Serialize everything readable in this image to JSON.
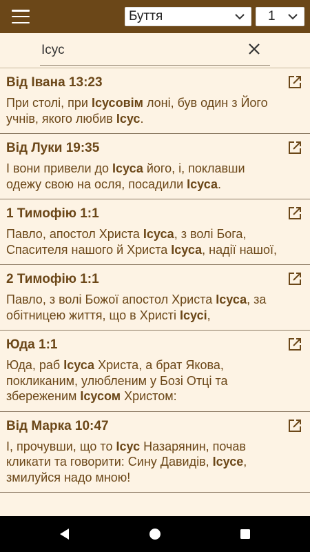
{
  "toolbar": {
    "menu_icon": "hamburger-menu-icon",
    "book": "Буття",
    "chapter": "1"
  },
  "search": {
    "value": "Ісус",
    "clear_icon": "close-icon"
  },
  "results": [
    {
      "ref": "Від Івана 13:23",
      "parts": [
        {
          "t": "При столі, при "
        },
        {
          "t": "Ісусовім",
          "b": true
        },
        {
          "t": " лоні, був один з Його учнів, якого любив "
        },
        {
          "t": "Ісус",
          "b": true
        },
        {
          "t": "."
        }
      ]
    },
    {
      "ref": "Від Луки 19:35",
      "parts": [
        {
          "t": "І вони привели до "
        },
        {
          "t": "Ісуса",
          "b": true
        },
        {
          "t": " його, і, поклавши одежу свою на осля, посадили "
        },
        {
          "t": "Ісуса",
          "b": true
        },
        {
          "t": "."
        }
      ]
    },
    {
      "ref": "1 Тимофію 1:1",
      "parts": [
        {
          "t": "Павло, апостол Христа "
        },
        {
          "t": "Ісуса",
          "b": true
        },
        {
          "t": ", з волі Бога, Спасителя нашого й Христа "
        },
        {
          "t": "Ісуса",
          "b": true
        },
        {
          "t": ", надії нашої,"
        }
      ]
    },
    {
      "ref": "2 Тимофію 1:1",
      "parts": [
        {
          "t": "Павло, з волі Божої апостол Христа "
        },
        {
          "t": "Ісуса",
          "b": true
        },
        {
          "t": ", за обітницею життя, що в Христі "
        },
        {
          "t": "Ісусі",
          "b": true
        },
        {
          "t": ","
        }
      ]
    },
    {
      "ref": "Юда 1:1",
      "parts": [
        {
          "t": "Юда, раб "
        },
        {
          "t": "Ісуса",
          "b": true
        },
        {
          "t": " Христа, а брат Якова, покликаним, улюбленим у Бозі Отці та збереженим "
        },
        {
          "t": "Ісусом",
          "b": true
        },
        {
          "t": " Христом:"
        }
      ]
    },
    {
      "ref": "Від Марка 10:47",
      "parts": [
        {
          "t": "І, прочувши, що то "
        },
        {
          "t": "Ісус",
          "b": true
        },
        {
          "t": " Назарянин, почав кликати та говорити: Сину Давидів, "
        },
        {
          "t": "Ісусе",
          "b": true
        },
        {
          "t": ", змилуйся надо мною!"
        }
      ]
    }
  ],
  "result_action_icon": "open-in-new-icon",
  "navbar": {
    "back_icon": "back-triangle-icon",
    "home_icon": "home-circle-icon",
    "recents_icon": "recents-square-icon"
  },
  "colors": {
    "header": "#6b4718",
    "background": "#fdf3e4",
    "text": "#6b4718",
    "divider": "#8c7a63"
  }
}
